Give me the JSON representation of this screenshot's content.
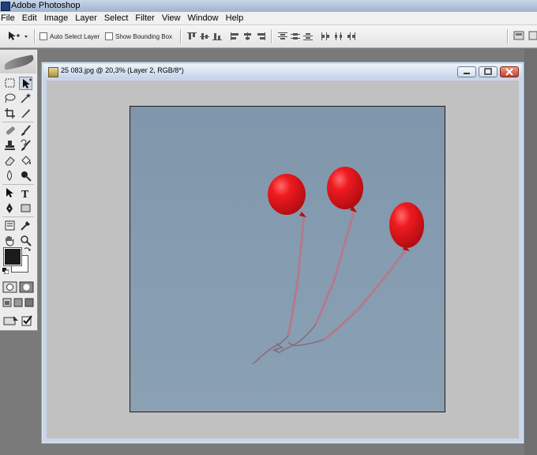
{
  "app": {
    "title": "Adobe Photoshop"
  },
  "menu": [
    "File",
    "Edit",
    "Image",
    "Layer",
    "Select",
    "Filter",
    "View",
    "Window",
    "Help"
  ],
  "options": {
    "auto_select_label": "Auto Select Layer",
    "show_bounding_label": "Show Bounding Box"
  },
  "document": {
    "title": "25 083.jpg @ 20,3% (Layer 2, RGB/8*)"
  },
  "colors": {
    "foreground": "#1b1b1b",
    "background": "#ffffff",
    "sky": "#8499ae",
    "balloon": "#e3161b"
  }
}
